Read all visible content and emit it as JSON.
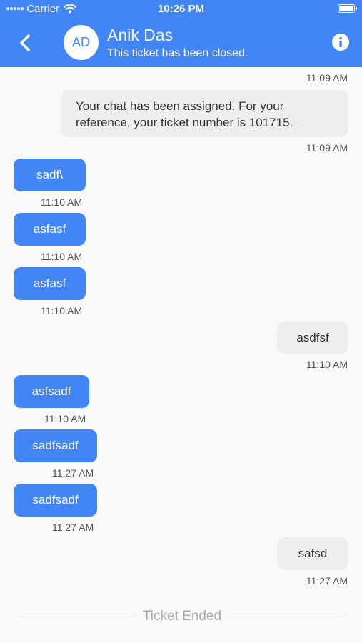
{
  "status_bar": {
    "carrier": "Carrier",
    "time": "10:26 PM"
  },
  "header": {
    "avatar_initials": "AD",
    "title": "Anik Das",
    "subtitle": "This ticket has been closed.",
    "accent_color": "#4285f4"
  },
  "messages": [
    {
      "time": "11:09 AM"
    },
    {
      "text_line1": "Your chat has been assigned. For your",
      "text_line2": "reference, your ticket number is 101715.",
      "time": "11:09 AM"
    },
    {
      "text": "sadf\\",
      "time": "11:10 AM"
    },
    {
      "text": "asfasf",
      "time": "11:10 AM"
    },
    {
      "text": "asfasf",
      "time": "11:10 AM"
    },
    {
      "text": "asdfsf",
      "time": "11:10 AM"
    },
    {
      "text": "asfsadf",
      "time": "11:10 AM"
    },
    {
      "text": "sadfsadf",
      "time": "11:27 AM"
    },
    {
      "text": "sadfsadf",
      "time": "11:27 AM"
    },
    {
      "text": "safsd",
      "time": "11:27 AM"
    }
  ],
  "footer": {
    "ended_label": "Ticket Ended"
  }
}
